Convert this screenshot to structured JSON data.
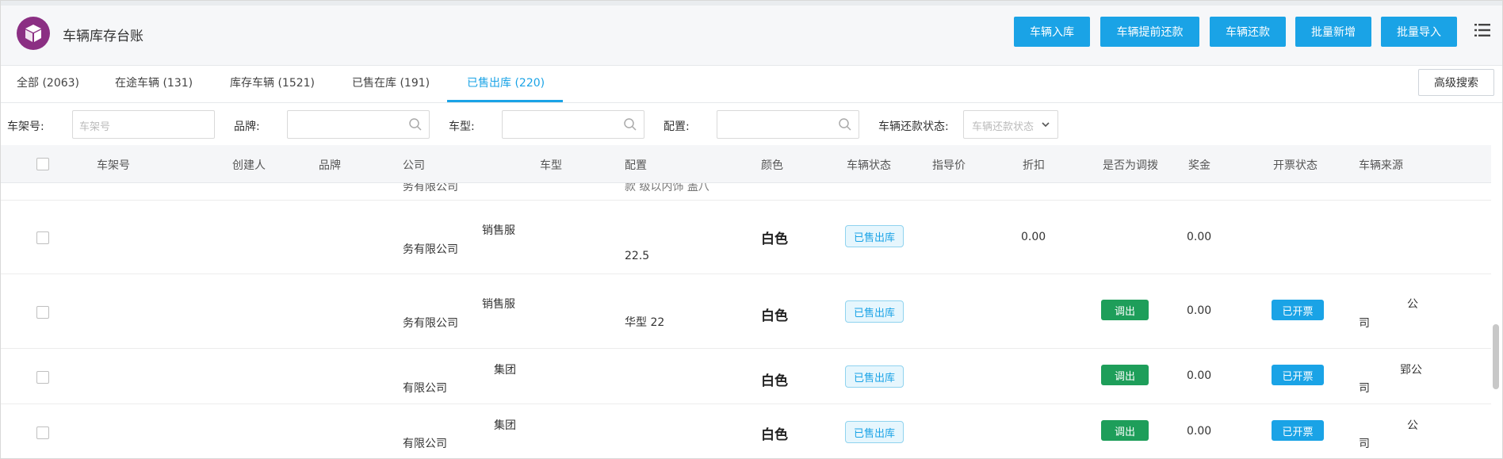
{
  "header": {
    "title": "车辆库存台账",
    "buttons": [
      "车辆入库",
      "车辆提前还款",
      "车辆还款",
      "批量新增",
      "批量导入"
    ]
  },
  "tabs": [
    "全部 (2063)",
    "在途车辆 (131)",
    "库存车辆 (1521)",
    "已售在库 (191)",
    "已售出库 (220)"
  ],
  "advanced_search": "高级搜索",
  "filters": {
    "vin_label": "车架号:",
    "vin_placeholder": "车架号",
    "brand_label": "品牌:",
    "model_label": "车型:",
    "config_label": "配置:",
    "repay_label": "车辆还款状态:",
    "repay_placeholder": "车辆还款状态"
  },
  "columns": [
    "车架号",
    "创建人",
    "品牌",
    "公司",
    "车型",
    "配置",
    "颜色",
    "车辆状态",
    "指导价",
    "折扣",
    "是否为调拨",
    "奖金",
    "开票状态",
    "车辆来源"
  ],
  "rows": [
    {
      "company_top": "务有限公司",
      "config_top": "款 级以内饰 盖八"
    },
    {
      "company_a": "销售服",
      "company_b": "务有限公司",
      "config": "22.5",
      "color": "白色",
      "status": "已售出库",
      "discount": "0.00",
      "bonus": "0.00"
    },
    {
      "company_a": "销售服",
      "company_b": "务有限公司",
      "config": "华型 22",
      "color": "白色",
      "status": "已售出库",
      "transfer": "调出",
      "bonus": "0.00",
      "invoice": "已开票",
      "source_a": "公",
      "source_b": "司"
    },
    {
      "company_a": "集团",
      "company_b": "有限公司",
      "color": "白色",
      "status": "已售出库",
      "transfer": "调出",
      "bonus": "0.00",
      "invoice": "已开票",
      "source_a": "郢公",
      "source_b": "司"
    },
    {
      "company_a": "集团",
      "company_b": "有限公司",
      "color": "白色",
      "status": "已售出库",
      "transfer": "调出",
      "bonus": "0.00",
      "invoice": "已开票",
      "source_a": "公",
      "source_b": "司"
    }
  ]
}
